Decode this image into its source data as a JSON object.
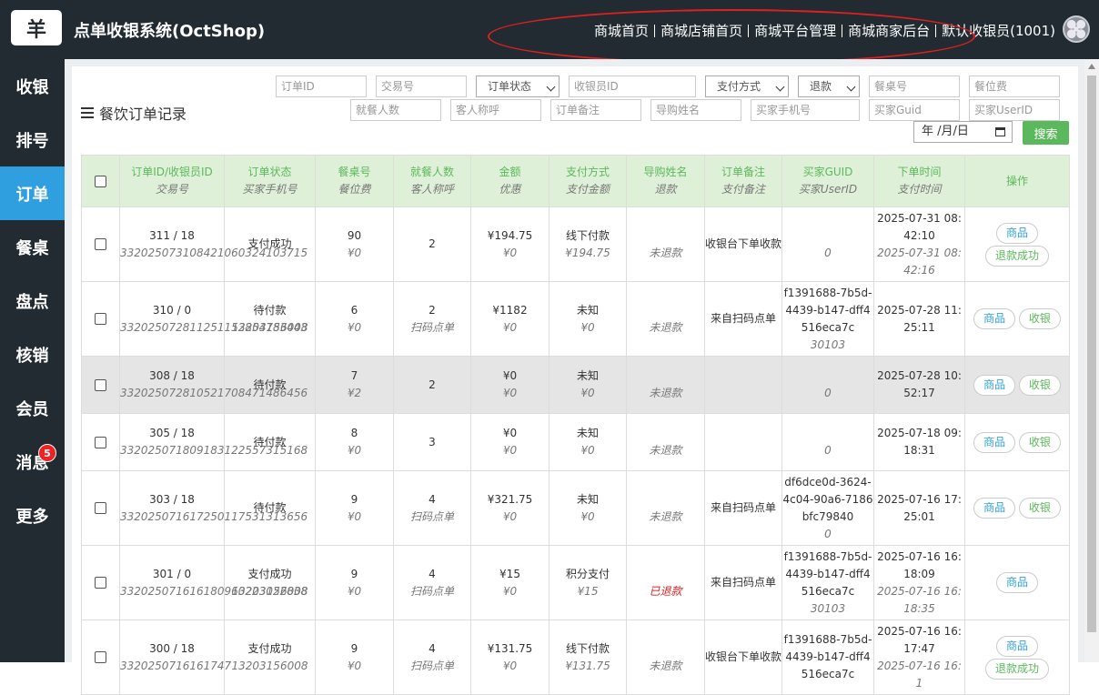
{
  "header": {
    "logo_glyph": "羊",
    "app_title": "点单收银系统(OctShop)",
    "nav": [
      "商城首页",
      "商城店铺首页",
      "商城平台管理",
      "商城商家后台"
    ],
    "user": "默认收银员(1001)"
  },
  "sidebar": {
    "items": [
      {
        "label": "收银"
      },
      {
        "label": "排号"
      },
      {
        "label": "订单",
        "active": true
      },
      {
        "label": "餐桌"
      },
      {
        "label": "盘点"
      },
      {
        "label": "核销"
      },
      {
        "label": "会员"
      },
      {
        "label": "消息",
        "badge": "5"
      },
      {
        "label": "更多"
      }
    ]
  },
  "page": {
    "title": "餐饮订单记录"
  },
  "filters": {
    "order_id": "订单ID",
    "trade_no": "交易号",
    "order_status": "订单状态",
    "cashier_id": "收银员ID",
    "pay_method": "支付方式",
    "refund": "退款",
    "table_no": "餐桌号",
    "seat_fee": "餐位费",
    "diners": "就餐人数",
    "guest_title": "客人称呼",
    "order_note": "订单备注",
    "guide_name": "导购姓名",
    "buyer_phone": "买家手机号",
    "buyer_guid": "买家Guid",
    "buyer_userid": "买家UserID",
    "date": "年 /月/日",
    "search_label": "搜索"
  },
  "table": {
    "headers": [
      {
        "main": "订单ID/收银员ID",
        "sub": "交易号"
      },
      {
        "main": "订单状态",
        "sub": "买家手机号"
      },
      {
        "main": "餐桌号",
        "sub": "餐位费"
      },
      {
        "main": "就餐人数",
        "sub": "客人称呼"
      },
      {
        "main": "金额",
        "sub": "优惠"
      },
      {
        "main": "支付方式",
        "sub": "支付金额"
      },
      {
        "main": "导购姓名",
        "sub": "退款"
      },
      {
        "main": "订单备注",
        "sub": "支付备注"
      },
      {
        "main": "买家GUID",
        "sub": "买家UserID"
      },
      {
        "main": "下单时间",
        "sub": "支付时间"
      },
      {
        "main": "操作",
        "sub": ""
      }
    ],
    "rows": [
      {
        "id": "311 / 18",
        "trade": "332025073108421060324103715",
        "status": "支付成功",
        "phone": "",
        "table": "90",
        "seat_fee": "¥0",
        "diners": "2",
        "guest": "",
        "amount": "¥194.75",
        "discount": "¥0",
        "pay": "线下付款",
        "pay_amount": "¥194.75",
        "guide": "",
        "refund": "未退款",
        "note": "收银台下单收款",
        "guid": "",
        "userid": "0",
        "order_time": "2025-07-31 08:42:10",
        "pay_time": "2025-07-31 08:42:16",
        "actions": [
          "商品",
          "退款成功"
        ]
      },
      {
        "id": "310 / 0",
        "trade": "332025072811251152854783443",
        "status": "待付款",
        "phone": "13203156008",
        "table": "6",
        "seat_fee": "¥0",
        "diners": "2",
        "guest": "扫码点单",
        "amount": "¥1182",
        "discount": "¥0",
        "pay": "未知",
        "pay_amount": "¥0",
        "guide": "",
        "refund": "未退款",
        "note": "来自扫码点单",
        "guid": "f1391688-7b5d-4439-b147-dff4516eca7c",
        "userid": "30103",
        "order_time": "2025-07-28 11:25:11",
        "pay_time": "",
        "actions": [
          "商品",
          "收银"
        ]
      },
      {
        "id": "308 / 18",
        "trade": "332025072810521708471486456",
        "status": "待付款",
        "phone": "",
        "table": "7",
        "seat_fee": "¥2",
        "diners": "2",
        "guest": "",
        "amount": "¥0",
        "discount": "¥0",
        "pay": "未知",
        "pay_amount": "¥0",
        "guide": "",
        "refund": "未退款",
        "note": "",
        "guid": "",
        "userid": "0",
        "order_time": "2025-07-28 10:52:17",
        "pay_time": "",
        "actions": [
          "商品",
          "收银"
        ],
        "highlight": true
      },
      {
        "id": "305 / 18",
        "trade": "332025071809183122557315168",
        "status": "待付款",
        "phone": "",
        "table": "8",
        "seat_fee": "¥0",
        "diners": "3",
        "guest": "",
        "amount": "¥0",
        "discount": "¥0",
        "pay": "未知",
        "pay_amount": "¥0",
        "guide": "",
        "refund": "未退款",
        "note": "",
        "guid": "",
        "userid": "0",
        "order_time": "2025-07-18 09:18:31",
        "pay_time": "",
        "actions": [
          "商品",
          "收银"
        ]
      },
      {
        "id": "303 / 18",
        "trade": "332025071617250117531313656",
        "status": "待付款",
        "phone": "",
        "table": "9",
        "seat_fee": "¥0",
        "diners": "4",
        "guest": "扫码点单",
        "amount": "¥321.75",
        "discount": "¥0",
        "pay": "未知",
        "pay_amount": "¥0",
        "guide": "",
        "refund": "未退款",
        "note": "来自扫码点单",
        "guid": "df6dce0d-3624-4c04-90a6-7186bfc79840",
        "userid": "0",
        "order_time": "2025-07-16 17:25:01",
        "pay_time": "",
        "actions": [
          "商品",
          "收银"
        ]
      },
      {
        "id": "301 / 0",
        "trade": "332025071616180960223022838",
        "status": "支付成功",
        "phone": "13203156008",
        "table": "9",
        "seat_fee": "¥0",
        "diners": "4",
        "guest": "扫码点单",
        "amount": "¥15",
        "discount": "¥0",
        "pay": "积分支付",
        "pay_amount": "¥15",
        "guide": "",
        "refund": "已退款",
        "refund_red": true,
        "note": "来自扫码点单",
        "guid": "f1391688-7b5d-4439-b147-dff4516eca7c",
        "userid": "30103",
        "order_time": "2025-07-16 16:18:09",
        "pay_time": "2025-07-16 16:18:35",
        "actions": [
          "商品"
        ]
      },
      {
        "id": "300 / 18",
        "trade": "3320250716161747",
        "status": "支付成功",
        "phone": "13203156008",
        "table": "9",
        "seat_fee": "¥0",
        "diners": "4",
        "guest": "扫码点单",
        "amount": "¥131.75",
        "discount": "¥0",
        "pay": "线下付款",
        "pay_amount": "¥131.75",
        "guide": "",
        "refund": "未退款",
        "note": "收银台下单收款",
        "guid": "f1391688-7b5d-4439-b147-dff4516eca7c",
        "userid": "",
        "order_time": "2025-07-16 16:17:47",
        "pay_time": "2025-07-16 16:1",
        "actions": [
          "商品",
          "退款成功"
        ]
      }
    ]
  }
}
